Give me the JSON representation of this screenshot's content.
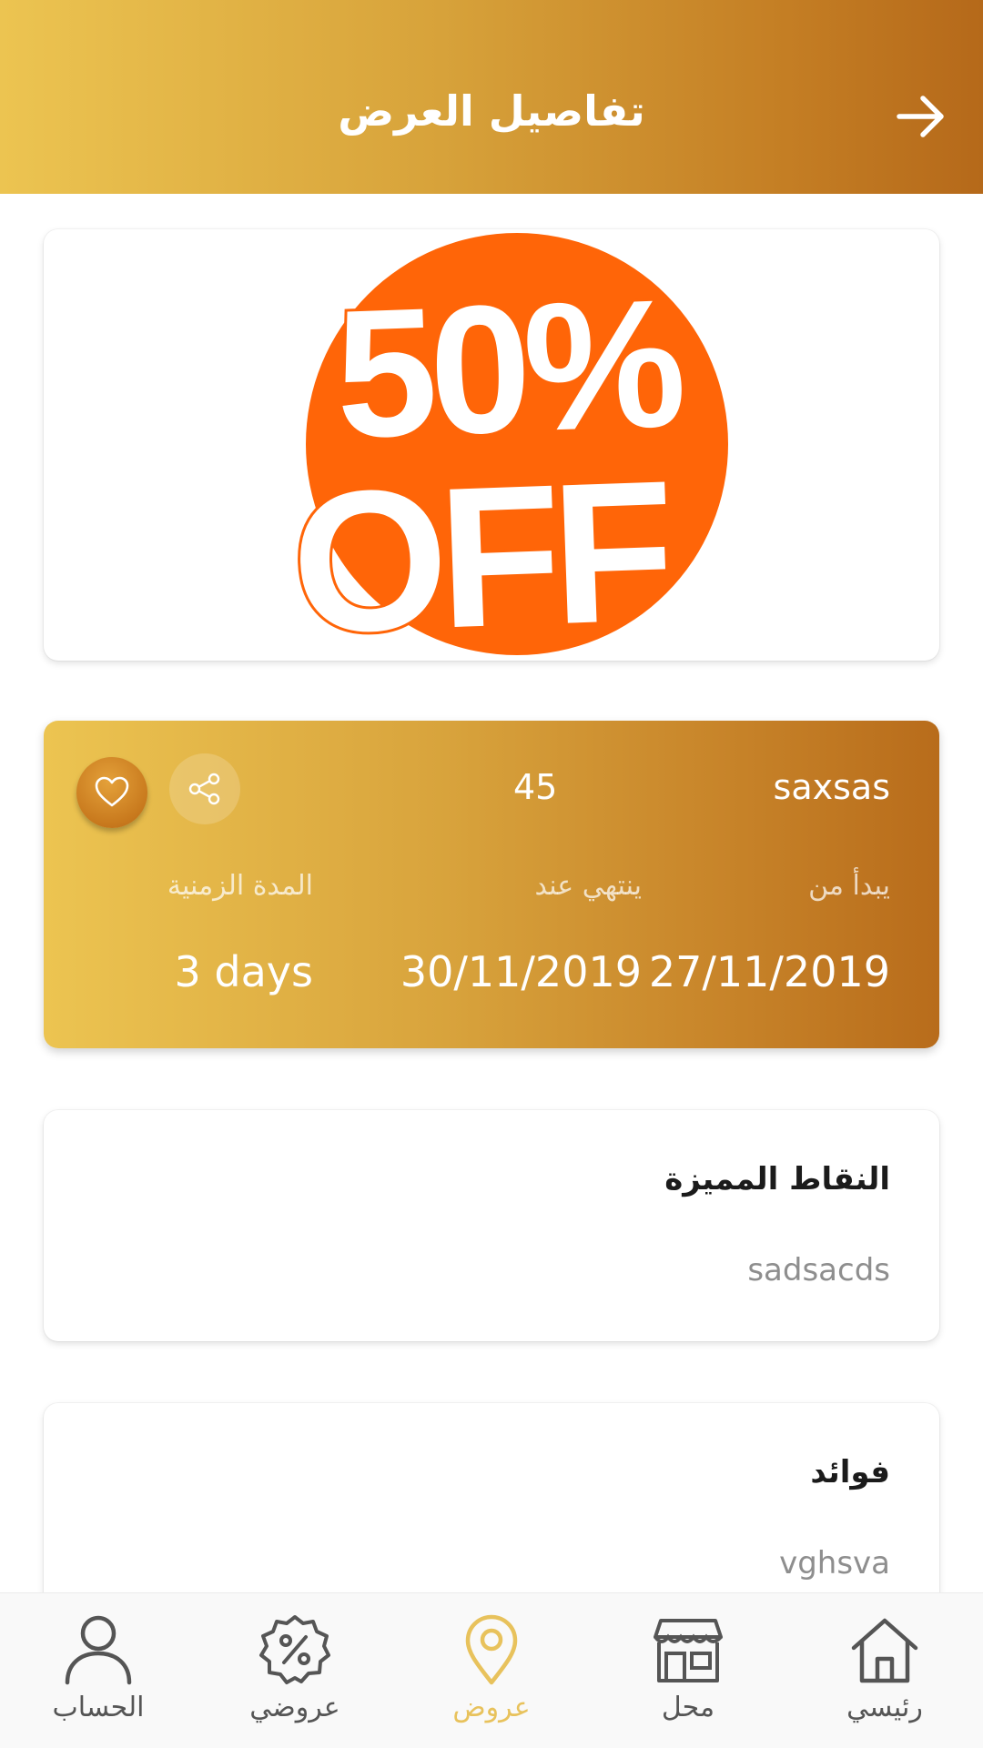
{
  "header": {
    "title": "تفاصيل العرض"
  },
  "banner": {
    "percent_text": "50%",
    "off_text": "OFF",
    "brand_color": "#ff6508"
  },
  "offer": {
    "name": "saxsas",
    "points": "45",
    "labels": {
      "start": "يبدأ من",
      "end": "ينتهي عند",
      "duration": "المدة الزمنية"
    },
    "values": {
      "start": "27/11/2019",
      "end": "30/11/2019",
      "duration": "3 days"
    }
  },
  "highlights": {
    "title": "النقاط المميزة",
    "body": "sadsacds"
  },
  "benefits": {
    "title": "فوائد",
    "body": "vghsva"
  },
  "bottom_nav": {
    "items": [
      {
        "label": "رئيسي",
        "icon": "home-icon"
      },
      {
        "label": "محل",
        "icon": "store-icon"
      },
      {
        "label": "عروض",
        "icon": "location-pin-icon",
        "active": true
      },
      {
        "label": "عروضي",
        "icon": "discount-badge-icon"
      },
      {
        "label": "الحساب",
        "icon": "user-icon"
      }
    ],
    "active_color": "#e8c25c"
  }
}
